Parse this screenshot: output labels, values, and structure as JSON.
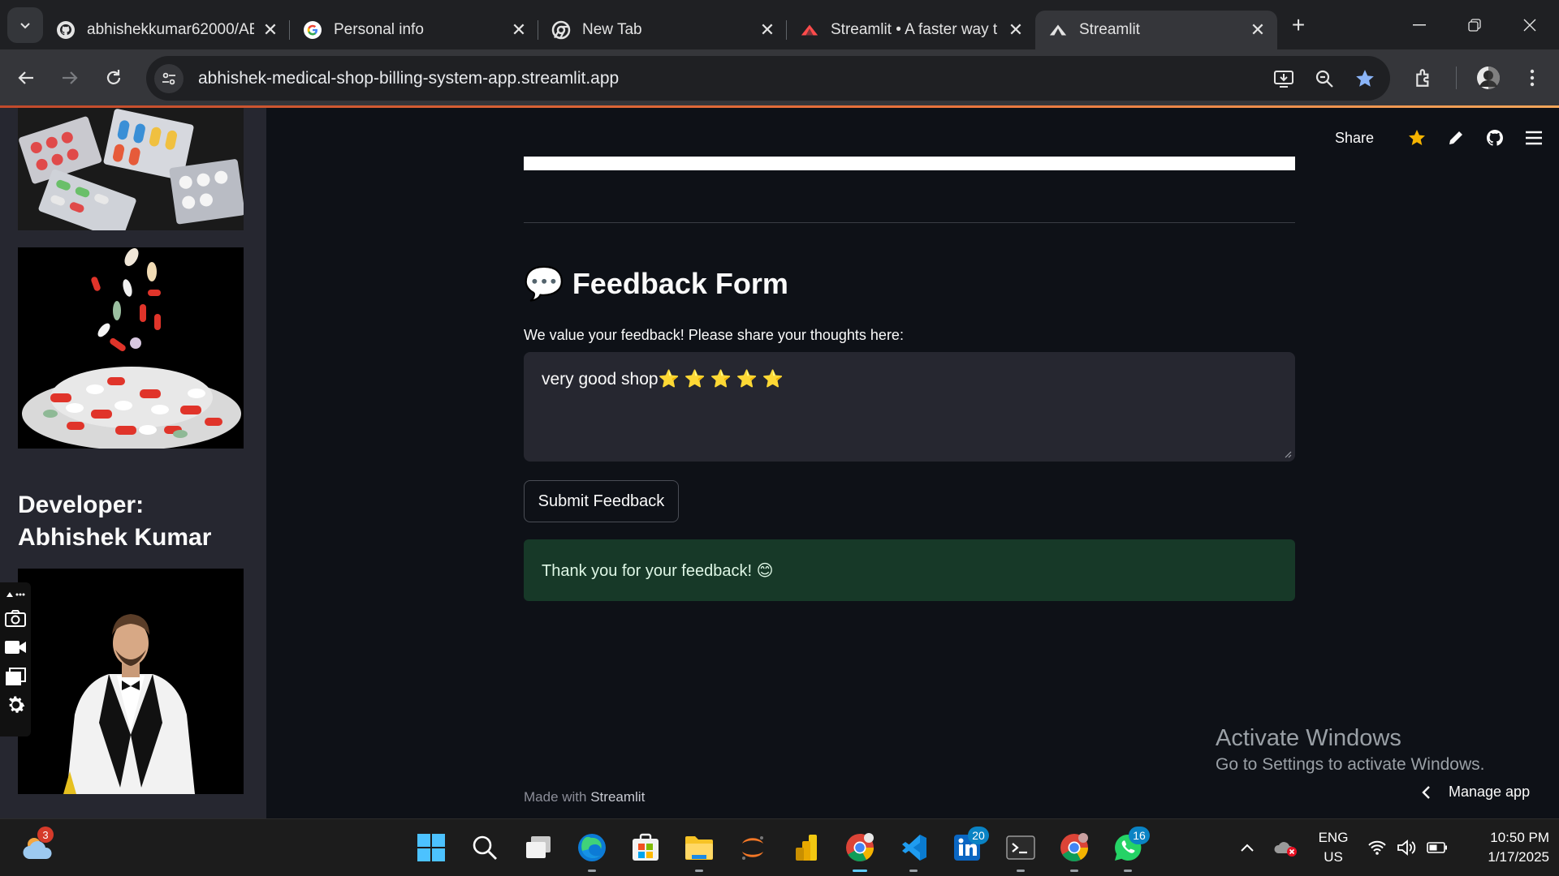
{
  "browser": {
    "tabs": [
      {
        "title": "abhishekkumar62000/AB",
        "icon": "github-icon"
      },
      {
        "title": "Personal info",
        "icon": "google-icon"
      },
      {
        "title": "New Tab",
        "icon": "chrome-icon"
      },
      {
        "title": "Streamlit • A faster way t",
        "icon": "streamlit-icon"
      },
      {
        "title": "Streamlit",
        "icon": "streamlit-icon",
        "active": true
      }
    ],
    "url": "abhishek-medical-shop-billing-system-app.streamlit.app"
  },
  "sidebar": {
    "developer_line1": "Developer:",
    "developer_line2": "Abhishek Kumar"
  },
  "header": {
    "share_label": "Share"
  },
  "feedback": {
    "icon": "💬",
    "title": "Feedback Form",
    "label": "We value your feedback! Please share your thoughts here:",
    "value": "very good shop⭐ ⭐ ⭐ ⭐ ⭐",
    "submit_label": "Submit Feedback",
    "success_message": "Thank you for your feedback! 😊"
  },
  "footer": {
    "prefix": "Made with",
    "brand": "Streamlit"
  },
  "manage_app_label": "Manage app",
  "watermark": {
    "line1": "Activate Windows",
    "line2": "Go to Settings to activate Windows."
  },
  "taskbar": {
    "weather_badge": "3",
    "linkedin_badge": "20",
    "whatsapp_badge": "16",
    "lang_line1": "ENG",
    "lang_line2": "US",
    "time": "10:50 PM",
    "date": "1/17/2025"
  },
  "colors": {
    "app_bg": "#0e1117",
    "sidebar_bg": "#262730",
    "success_bg": "#173928",
    "accent": "#ff4b4b"
  }
}
